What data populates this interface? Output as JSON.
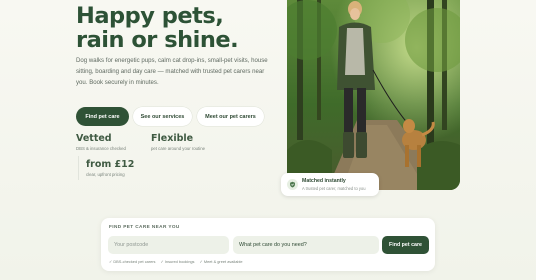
{
  "hero": {
    "title_line1": "Happy pets,",
    "title_line2": "rain or shine.",
    "description": "Dog walks for energetic pups, calm cat drop-ins, small-pet visits, house sitting, boarding and day care — matched with trusted pet carers near you. Book securely in minutes."
  },
  "buttons": {
    "primary": "Find pet care",
    "services": "See our services",
    "carers": "Meet our pet carers"
  },
  "stats": [
    {
      "title": "Vetted",
      "sub": "DBS & insurance checked"
    },
    {
      "title": "Flexible",
      "sub": "pet care around your routine"
    },
    {
      "title": "from £12",
      "sub": "clear, upfront pricing"
    }
  ],
  "badge": {
    "icon": "shield-check-icon",
    "title": "Matched instantly",
    "sub": "A trusted pet carer, matched to you"
  },
  "search": {
    "heading": "FIND PET CARE NEAR YOU",
    "postcode_placeholder": "Your postcode",
    "service_value": "What pet care do you need?",
    "button": "Find pet care",
    "perks": [
      "✓ DBS-checked pet carers",
      "✓ Insured bookings",
      "✓ Meet & greet available"
    ]
  },
  "colors": {
    "brand": "#2f5236",
    "background": "#f6f7f1",
    "field": "#edf1e8"
  }
}
